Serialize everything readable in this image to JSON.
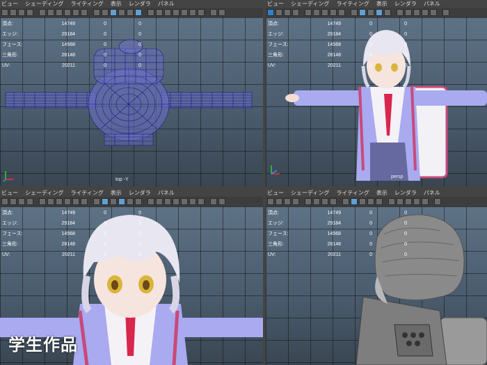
{
  "menu": [
    "ビュー",
    "シェーディング",
    "ライティング",
    "表示",
    "レンダラ",
    "パネル"
  ],
  "hud": {
    "rows": [
      {
        "label": "頂点:",
        "value": "14749",
        "z1": "0",
        "z2": "0"
      },
      {
        "label": "エッジ:",
        "value": "29184",
        "z1": "0",
        "z2": "0"
      },
      {
        "label": "フェース:",
        "value": "14568",
        "z1": "0",
        "z2": "0"
      },
      {
        "label": "三角形:",
        "value": "28148",
        "z1": "0",
        "z2": "0"
      },
      {
        "label": "UV:",
        "value": "20211",
        "z1": "0",
        "z2": "0"
      }
    ]
  },
  "panes": [
    {
      "name": "top",
      "camera_label": "top -Y"
    },
    {
      "name": "persp",
      "camera_label": "persp"
    },
    {
      "name": "front",
      "camera_label": ""
    },
    {
      "name": "side",
      "camera_label": ""
    }
  ],
  "watermark": "学生作品",
  "colors": {
    "wireframe": "#1a1a8a",
    "hair": "#e8e6f0",
    "jacket": "#a9aaf0",
    "tie": "#d8264c",
    "bag_strap": "#c84a7a",
    "grey_model": "#8a8a8a"
  },
  "icons": {
    "axis": "xyz-axis-icon",
    "toolbar": "toolbar-button-icon"
  }
}
